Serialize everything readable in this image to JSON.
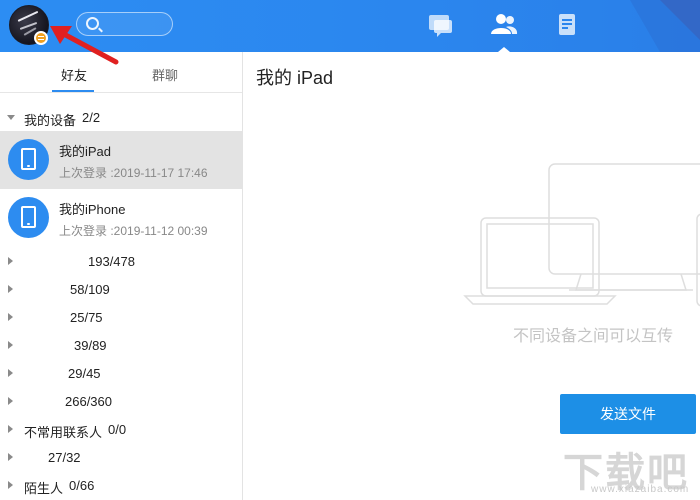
{
  "header": {
    "search": {
      "placeholder": ""
    },
    "nav": [
      {
        "name": "messages",
        "icon": "chat-icon",
        "active": false
      },
      {
        "name": "contacts",
        "icon": "contacts-icon",
        "active": true
      },
      {
        "name": "files",
        "icon": "document-icon",
        "active": false
      }
    ],
    "brand_color": "#2d8cf0"
  },
  "sidebar": {
    "tabs": [
      {
        "label": "好友",
        "active": true
      },
      {
        "label": "群聊",
        "active": false
      }
    ],
    "my_devices": {
      "name": "我的设备",
      "count": "2/2",
      "expanded": true,
      "devices": [
        {
          "name": "我的iPad",
          "last_login": "上次登录 :2019-11-17 17:46",
          "selected": true
        },
        {
          "name": "我的iPhone",
          "last_login": "上次登录 :2019-11-12 00:39",
          "selected": false
        }
      ]
    },
    "groups": [
      {
        "name": "",
        "count": "193/478"
      },
      {
        "name": "",
        "count": "58/109"
      },
      {
        "name": "",
        "count": "25/75"
      },
      {
        "name": "",
        "count": "39/89"
      },
      {
        "name": "",
        "count": "29/45"
      },
      {
        "name": "",
        "count": "266/360"
      },
      {
        "name": "不常用联系人",
        "count": "0/0"
      },
      {
        "name": "",
        "count": "27/32"
      },
      {
        "name": "陌生人",
        "count": "0/66"
      }
    ]
  },
  "main": {
    "title": "我的 iPad",
    "hint": "不同设备之间可以互传",
    "send_button": "发送文件",
    "watermark": {
      "logo": "下载吧",
      "url": "www.xiazaiba.com"
    }
  }
}
